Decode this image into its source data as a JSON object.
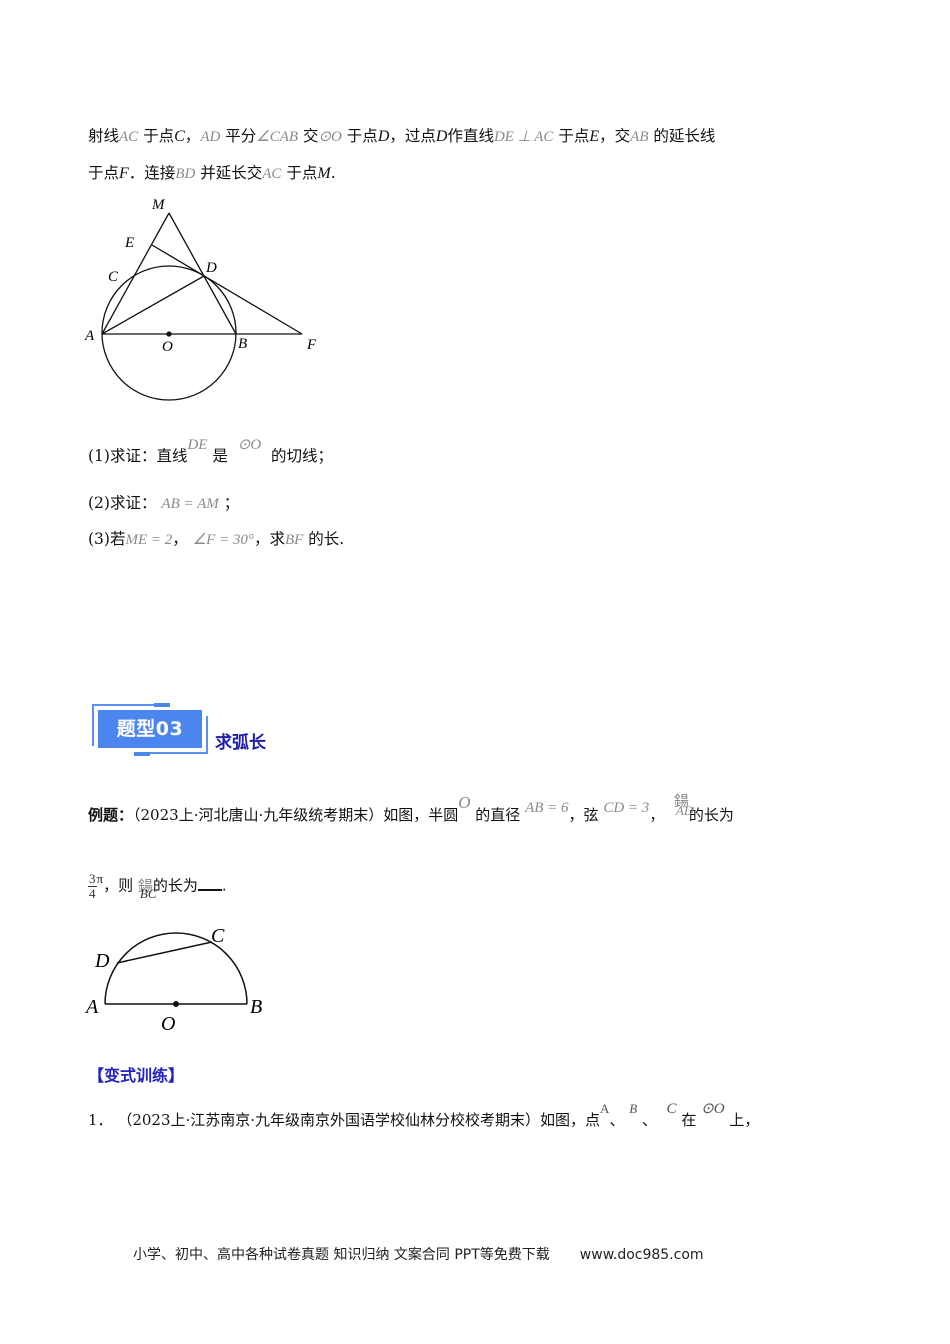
{
  "problem_intro": {
    "line1": [
      {
        "t": "射线",
        "k": "cn"
      },
      {
        "t": "AC",
        "k": "m"
      },
      {
        "t": " 于点",
        "k": "cn"
      },
      {
        "t": "C",
        "k": "mb"
      },
      {
        "t": "，",
        "k": "cn"
      },
      {
        "t": "AD",
        "k": "m"
      },
      {
        "t": " 平分",
        "k": "cn"
      },
      {
        "t": "∠CAB",
        "k": "m"
      },
      {
        "t": " 交",
        "k": "cn"
      },
      {
        "t": "⊙O",
        "k": "m"
      },
      {
        "t": " 于点",
        "k": "cn"
      },
      {
        "t": "D",
        "k": "mb"
      },
      {
        "t": "，过点",
        "k": "cn"
      },
      {
        "t": "D",
        "k": "mb"
      },
      {
        "t": "作直线",
        "k": "cn"
      },
      {
        "t": "DE ⊥ AC",
        "k": "m"
      },
      {
        "t": " 于点",
        "k": "cn"
      },
      {
        "t": "E",
        "k": "mb"
      },
      {
        "t": "，交",
        "k": "cn"
      },
      {
        "t": "AB",
        "k": "m"
      },
      {
        "t": " 的延长线",
        "k": "cn"
      }
    ],
    "line2": [
      {
        "t": "于点",
        "k": "cn"
      },
      {
        "t": "F",
        "k": "mb"
      },
      {
        "t": "．连接",
        "k": "cn"
      },
      {
        "t": "BD",
        "k": "m"
      },
      {
        "t": " 并延长交",
        "k": "cn"
      },
      {
        "t": "AC",
        "k": "m"
      },
      {
        "t": " 于点",
        "k": "cn"
      },
      {
        "t": "M",
        "k": "mb"
      },
      {
        "t": ".",
        "k": "cn"
      }
    ]
  },
  "figure1": {
    "labels": {
      "M": "M",
      "E": "E",
      "C": "C",
      "D": "D",
      "A": "A",
      "O": "O",
      "B": "B",
      "F": "F"
    }
  },
  "questions": {
    "q1": {
      "prefix": "(1)求证：直线",
      "math1": "DE",
      "mid": "是",
      "math2": "⊙O",
      "suffix": "的切线；"
    },
    "q2": {
      "prefix": "(2)求证：",
      "math1": "AB = AM",
      "suffix": "；"
    },
    "q3": {
      "prefix": "(3)若",
      "math1": "ME = 2",
      "sep": "，",
      "math2": "∠F = 30°",
      "mid": "，求",
      "math3": "BF",
      "suffix": "的长."
    }
  },
  "section": {
    "badge": "题型03",
    "title": "求弧长"
  },
  "example": {
    "label": "例题：",
    "text1": "（2023上·河北唐山·九年级统考期末）如图，半圆",
    "math_o": "O",
    "text2": "的直径",
    "math_ab": "AB = 6",
    "text3": "，弦",
    "math_cd": "CD = 3",
    "text4": "，",
    "arc_ad_glyph": "鍚",
    "arc_ad": "AD",
    "text5": "的长为",
    "frac_num": "3",
    "frac_den": "4",
    "pi": "π",
    "text6": "，则",
    "arc_bc_glyph": "鍚",
    "arc_bc": "BC",
    "text7": "的长为",
    "text8": "."
  },
  "figure2": {
    "labels": {
      "A": "A",
      "B": "B",
      "C": "C",
      "D": "D",
      "O": "O"
    }
  },
  "variant": {
    "heading": "【变式训练】",
    "item_number": "1．",
    "text1": "（2023上·江苏南京·九年级南京外国语学校仙林分校校考期末）如图，点",
    "math_a": "A",
    "sep1": "、",
    "math_b": "B",
    "sep2": "、",
    "math_c": "C",
    "text2": "在",
    "math_o": "⊙O",
    "text3": "上，"
  },
  "footer": {
    "text": "小学、初中、高中各种试卷真题  知识归纳  文案合同  PPT等免费下载",
    "url": "www.doc985.com"
  }
}
